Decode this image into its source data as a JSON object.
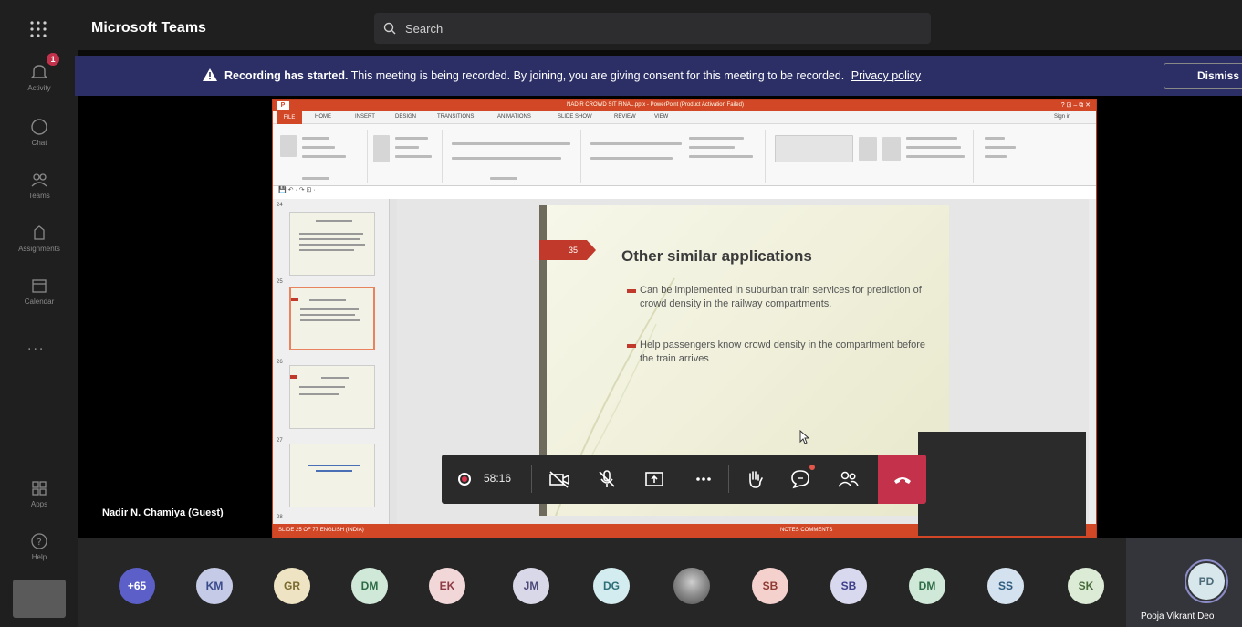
{
  "app": {
    "title": "Microsoft Teams"
  },
  "search": {
    "placeholder": "Search"
  },
  "rail": {
    "items": [
      {
        "label": "Activity",
        "icon": "bell-icon"
      },
      {
        "label": "Chat",
        "icon": "chat-icon"
      },
      {
        "label": "Teams",
        "icon": "teams-icon"
      },
      {
        "label": "Assignments",
        "icon": "assignments-icon"
      },
      {
        "label": "Calendar",
        "icon": "calendar-icon"
      },
      {
        "label": "Apps",
        "icon": "apps-icon"
      },
      {
        "label": "Help",
        "icon": "help-icon"
      }
    ],
    "activity_badge": "1",
    "more_label": "..."
  },
  "banner": {
    "bold": "Recording has started.",
    "text": "This meeting is being recorded. By joining, you are giving consent for this meeting to be recorded.",
    "link": "Privacy policy",
    "dismiss": "Dismiss"
  },
  "stage": {
    "presenter_name": "Nadir N. Chamiya (Guest)"
  },
  "ppt": {
    "window_title": "NADIR CROWD SIT FINAL.pptx - PowerPoint (Product Activation Failed)",
    "tabs": [
      "FILE",
      "HOME",
      "INSERT",
      "DESIGN",
      "TRANSITIONS",
      "ANIMATIONS",
      "SLIDE SHOW",
      "REVIEW",
      "VIEW"
    ],
    "sign_in": "Sign in",
    "window_controls": "? ⊡ – ⧉ ✕",
    "thumb_numbers": [
      "24",
      "25",
      "26",
      "27",
      "28"
    ],
    "status_left": "SLIDE 25 OF 77    ENGLISH (INDIA)",
    "status_right": "NOTES    COMMENTS"
  },
  "slide": {
    "number": "35",
    "title": "Other similar applications",
    "bullets": [
      "Can be implemented in suburban train services for prediction of crowd density in the railway compartments.",
      "Help passengers know crowd density in the compartment before the train arrives"
    ]
  },
  "controls": {
    "timer": "58:16",
    "icons": [
      "record-icon",
      "camera-off-icon",
      "mic-off-icon",
      "share-screen-icon",
      "more-icon",
      "raise-hand-icon",
      "chat-icon",
      "participants-icon",
      "hang-up-icon"
    ]
  },
  "participants": [
    {
      "initials": "+65",
      "bg": "#5b5fc7",
      "fg": "#ffffff"
    },
    {
      "initials": "KM",
      "bg": "#c5cbe6",
      "fg": "#3a4b8c"
    },
    {
      "initials": "GR",
      "bg": "#eee3c2",
      "fg": "#7a6a2e"
    },
    {
      "initials": "DM",
      "bg": "#cfe8d8",
      "fg": "#2d6b45"
    },
    {
      "initials": "EK",
      "bg": "#f2d7d9",
      "fg": "#8c3a44"
    },
    {
      "initials": "JM",
      "bg": "#d9d8e8",
      "fg": "#4c4a78"
    },
    {
      "initials": "DG",
      "bg": "#d3ecef",
      "fg": "#2f6f78"
    },
    {
      "initials": "",
      "bg": "photo",
      "fg": "#ffffff"
    },
    {
      "initials": "SB",
      "bg": "#f5d1cd",
      "fg": "#8e3b33"
    },
    {
      "initials": "SB",
      "bg": "#d8d8ee",
      "fg": "#40408a"
    },
    {
      "initials": "DM",
      "bg": "#cfe8d8",
      "fg": "#2d6b45"
    },
    {
      "initials": "SS",
      "bg": "#d3e2ee",
      "fg": "#2e5a7e"
    },
    {
      "initials": "SK",
      "bg": "#dcebd6",
      "fg": "#486b3a"
    }
  ],
  "pinned": {
    "initials": "PD",
    "name": "Pooja Vikrant Deo"
  }
}
